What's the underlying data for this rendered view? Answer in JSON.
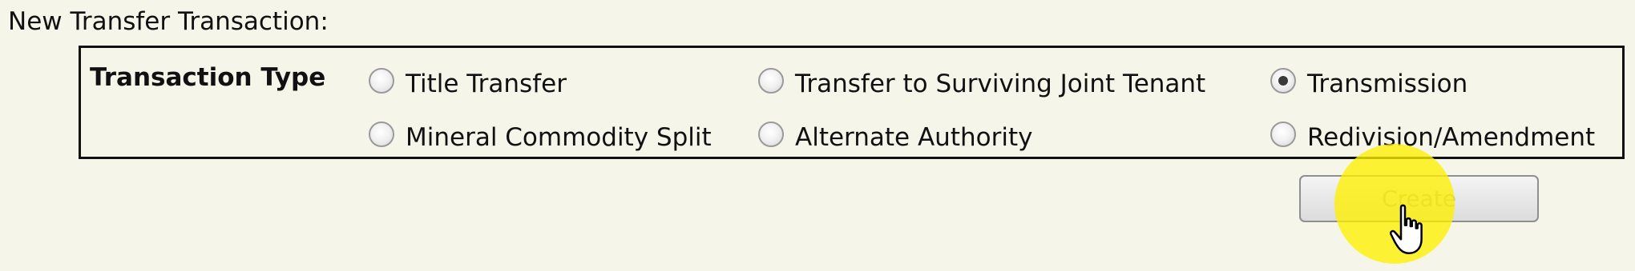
{
  "page": {
    "title": "New Transfer Transaction:"
  },
  "transaction_type": {
    "label": "Transaction Type",
    "selected": "Transmission",
    "options": [
      {
        "label": "Title Transfer",
        "checked": false
      },
      {
        "label": "Transfer to Surviving Joint Tenant",
        "checked": false
      },
      {
        "label": "Transmission",
        "checked": true
      },
      {
        "label": "Mineral Commodity Split",
        "checked": false
      },
      {
        "label": "Alternate Authority",
        "checked": false
      },
      {
        "label": "Redivision/Amendment",
        "checked": false
      }
    ]
  },
  "actions": {
    "create_label": "Create"
  },
  "overlay": {
    "cursor_icon": "hand-pointer-icon",
    "highlight_color": "#fff000"
  }
}
